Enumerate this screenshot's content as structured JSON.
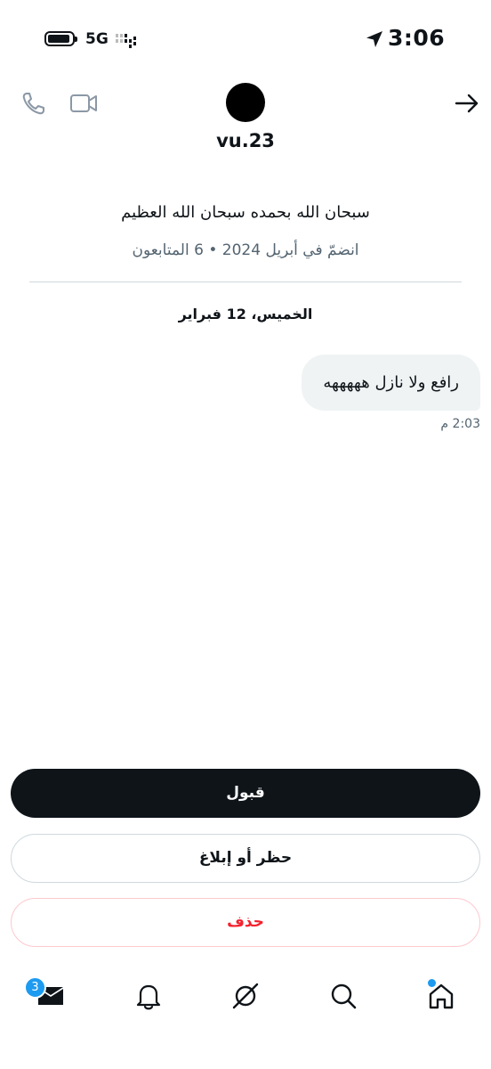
{
  "status_bar": {
    "time": "3:06",
    "network": "5G"
  },
  "header": {
    "username": "vu.23",
    "icons": [
      "phone-icon",
      "video-camera-icon",
      "back-arrow-icon"
    ]
  },
  "profile": {
    "bio": "سبحان الله بحمده سبحان الله العظيم",
    "meta": "انضمّ في أبريل 2024 • 6 المتابعون"
  },
  "conversation": {
    "date_separator": "الخميس، 12 فبراير",
    "messages": [
      {
        "text": "رافع ولا نازل هههههه",
        "time": "2:03 م"
      }
    ]
  },
  "actions": {
    "accept_label": "قبول",
    "block_report_label": "حظر أو إبلاغ",
    "delete_label": "حذف"
  },
  "bottom_nav": {
    "items": [
      "messages-icon",
      "notifications-bell-icon",
      "grok-icon",
      "search-icon",
      "home-icon"
    ],
    "messages_badge": "3"
  },
  "colors": {
    "accent": "#1d9bf0",
    "danger": "#f4212e",
    "primary_button": "#0f1419",
    "bubble": "#eff3f4"
  }
}
